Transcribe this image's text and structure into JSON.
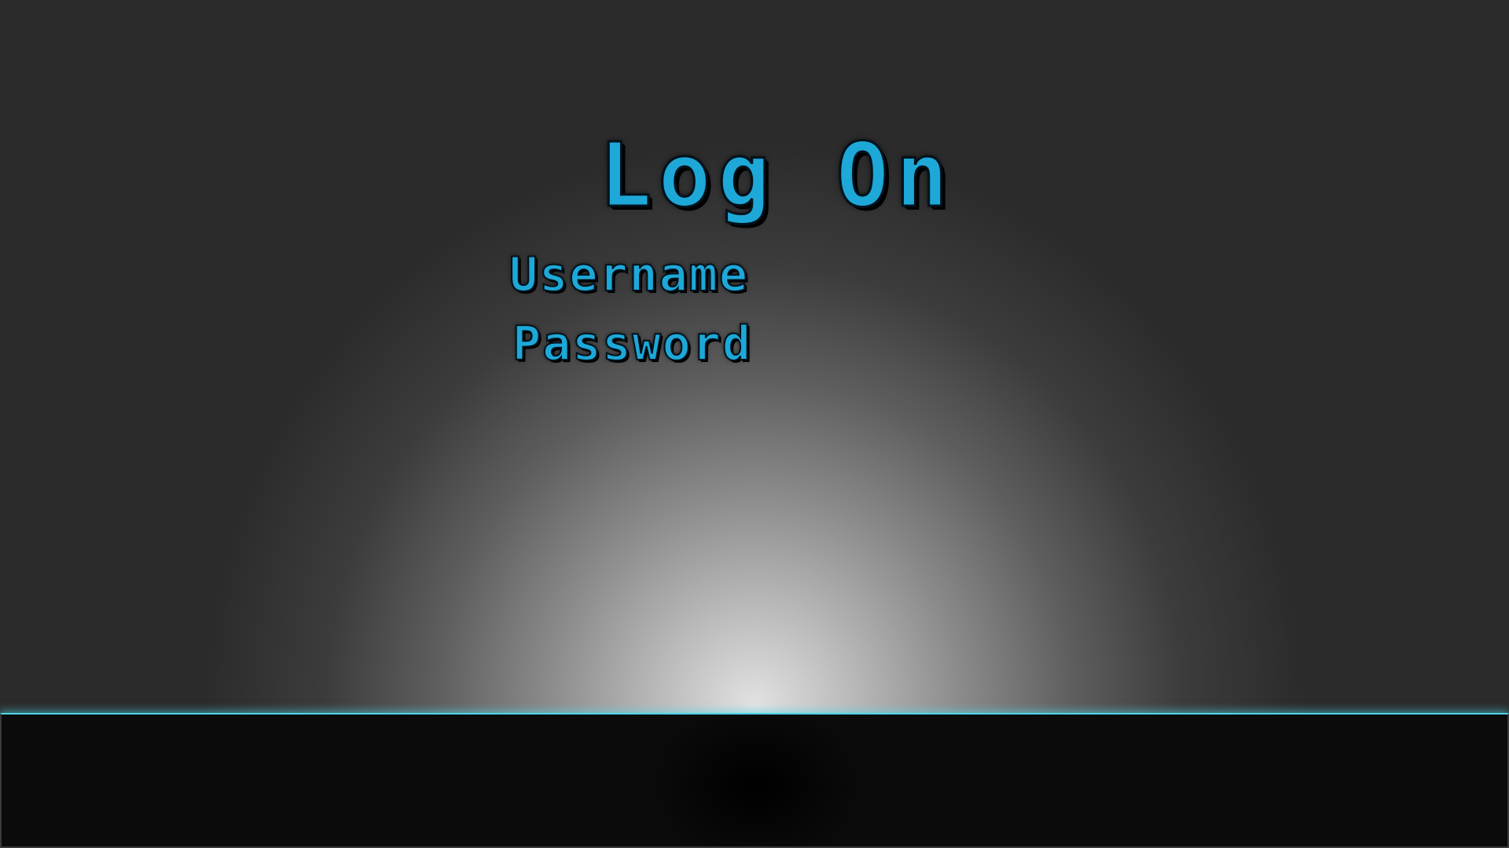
{
  "screen": {
    "title": "Log On",
    "fields": {
      "username_label": "Username",
      "password_label": "Password"
    }
  },
  "colors": {
    "text_accent": "#1ea8d8",
    "taskbar_glow": "#4fd6e6",
    "taskbar_bg": "#0b0b0b"
  }
}
